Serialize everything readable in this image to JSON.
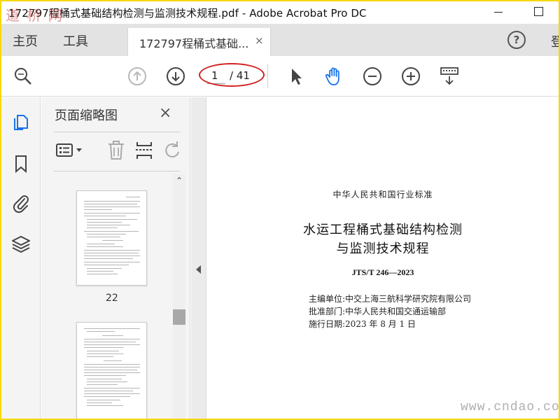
{
  "window": {
    "title": "172797程桶式基础结构检测与监测技术规程.pdf - Adobe Acrobat Pro DC"
  },
  "tabs": {
    "home": "主页",
    "tools": "工具",
    "document": "172797程桶式基础...",
    "close": "×",
    "help": "?",
    "signin": "登"
  },
  "toolbar": {
    "page_current": "1",
    "page_total": "/ 41"
  },
  "thumbnail_panel": {
    "title": "页面缩略图",
    "close": "×",
    "pages": [
      {
        "number": "22"
      }
    ]
  },
  "document": {
    "standard": "中华人民共和国行业标准",
    "title_line1": "水运工程桶式基础结构检测",
    "title_line2": "与监测技术规程",
    "code": "JTS/T 246—2023",
    "chief_unit": "主编单位:中交上海三航科学研究院有限公司",
    "approver": "批准部门:中华人民共和国交通运输部",
    "effective_date": "施行日期:2023 年 8 月 1 日"
  },
  "watermarks": {
    "logo": "道 桥 网",
    "site": "www.cndao.com"
  },
  "colors": {
    "frame": "#f6d80a",
    "accent_blue": "#1a73e8",
    "highlight_red": "#d21f1f"
  }
}
